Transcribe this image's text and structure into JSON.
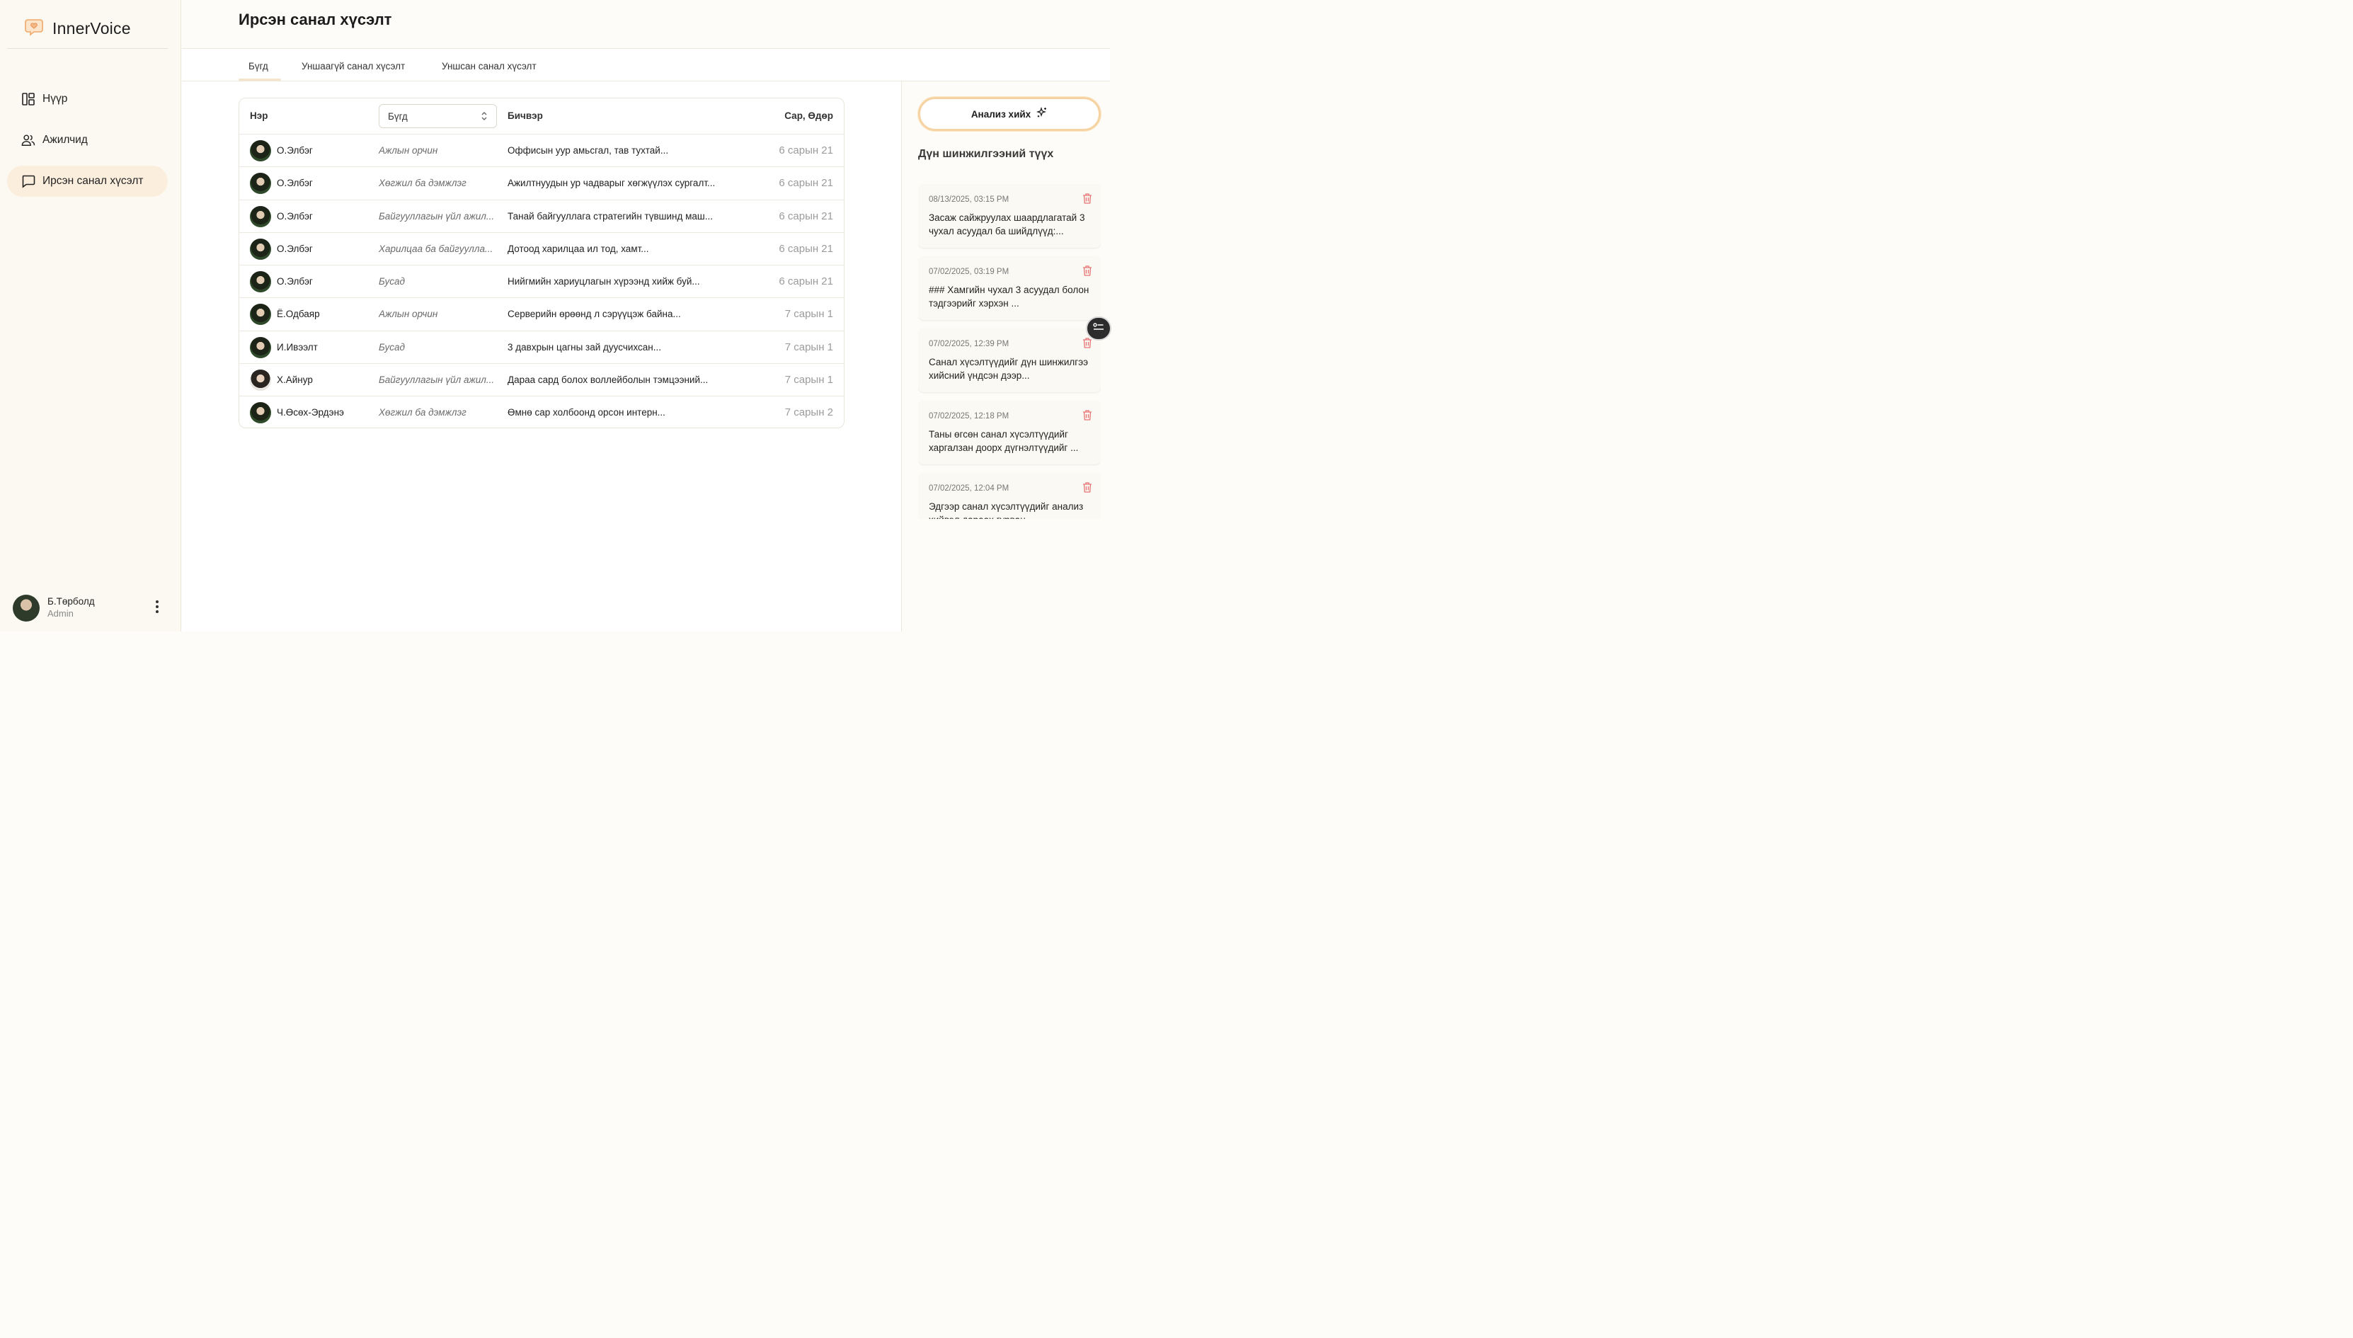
{
  "brand": {
    "name": "InnerVoice"
  },
  "sidebar": {
    "items": [
      {
        "label": "Нүүр",
        "icon": "dashboard-icon"
      },
      {
        "label": "Ажилчид",
        "icon": "users-icon"
      },
      {
        "label": "Ирсэн санал хүсэлт",
        "icon": "message-icon",
        "active": true
      }
    ],
    "user": {
      "name": "Б.Төрболд",
      "role": "Admin"
    }
  },
  "header": {
    "title": "Ирсэн санал хүсэлт"
  },
  "tabs": [
    {
      "label": "Бүгд",
      "active": true
    },
    {
      "label": "Уншаагүй санал хүсэлт"
    },
    {
      "label": "Уншсан санал хүсэлт"
    }
  ],
  "table": {
    "columns": {
      "name": "Нэр",
      "message": "Бичвэр",
      "date": "Сар, Өдөр"
    },
    "filter": {
      "selected": "Бүгд"
    },
    "rows": [
      {
        "name": "О.Элбэг",
        "category": "Ажлын орчин",
        "message": "Оффисын уур амьсгал, тав тухтай...",
        "date": "6 сарын 21"
      },
      {
        "name": "О.Элбэг",
        "category": "Хөгжил ба дэмжлэг",
        "message": "Ажилтнуудын ур чадварыг хөгжүүлэх сургалт...",
        "date": "6 сарын 21"
      },
      {
        "name": "О.Элбэг",
        "category": "Байгууллагын үйл ажил...",
        "message": "Танай байгууллага стратегийн түвшинд маш...",
        "date": "6 сарын 21"
      },
      {
        "name": "О.Элбэг",
        "category": "Харилцаа ба байгууллa...",
        "message": "Дотоод харилцаа ил тод, хамт...",
        "date": "6 сарын 21"
      },
      {
        "name": "О.Элбэг",
        "category": "Бусад",
        "message": "Нийгмийн хариуцлагын хүрээнд хийж буй...",
        "date": "6 сарын 21"
      },
      {
        "name": "Ё.Одбаяр",
        "category": "Ажлын орчин",
        "message": "Серверийн өрөөнд л сэрүүцэж байна...",
        "date": "7 сарын 1"
      },
      {
        "name": "И.Ивээлт",
        "category": "Бусад",
        "message": "3 давхрын цагны зай дуусчихсан...",
        "date": "7 сарын 1"
      },
      {
        "name": "Х.Айнур",
        "category": "Байгууллагын үйл ажил...",
        "message": "Дараа сард болох воллейболын тэмцээний...",
        "date": "7 сарын 1"
      },
      {
        "name": "Ч.Өсөх-Эрдэнэ",
        "category": "Хөгжил ба дэмжлэг",
        "message": "Өмнө сар холбоонд орсон интерн...",
        "date": "7 сарын 2"
      }
    ]
  },
  "analysis": {
    "button_label": "Анализ хийх",
    "history_title": "Дүн шинжилгээний түүх",
    "history": [
      {
        "date": "08/13/2025, 03:15 PM",
        "text": "Засаж сайжруулах шаардлагатай 3 чухал асуудал ба шийдлүүд:..."
      },
      {
        "date": "07/02/2025, 03:19 PM",
        "text": "### Хамгийн чухал 3 асуудал болон тэдгээрийг хэрхэн ..."
      },
      {
        "date": "07/02/2025, 12:39 PM",
        "text": "Санал хүсэлтүүдийг дүн шинжилгээ хийсний үндсэн дээр..."
      },
      {
        "date": "07/02/2025, 12:18 PM",
        "text": "Таны өгсөн санал хүсэлтүүдийг харгалзан доорх дүгнэлтүүдийг ..."
      },
      {
        "date": "07/02/2025, 12:04 PM",
        "text": "Эдгээр санал хүсэлтүүдийг анализ хийвэл дараах гурван..."
      }
    ]
  },
  "colors": {
    "accent": "#f6d3a2",
    "active_nav": "#fbeedd",
    "delete": "#e57373",
    "brand_icon": "#f0a868"
  }
}
